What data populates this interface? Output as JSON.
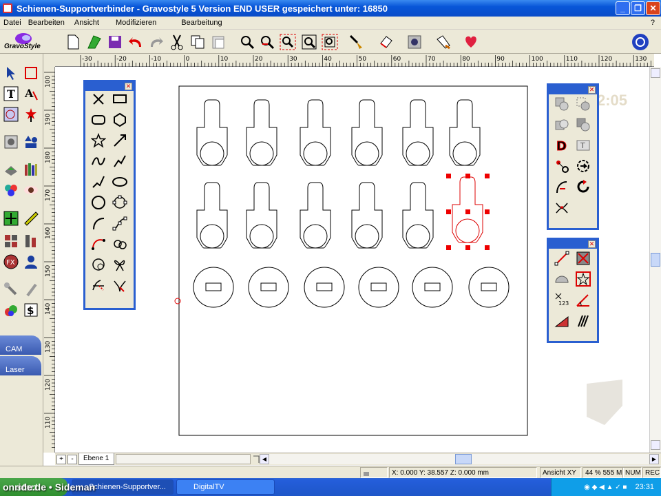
{
  "window": {
    "title": "Schienen-Supportverbinder - Gravostyle 5  Version END USER gespeichert unter: 16850",
    "minimize": "_",
    "maximize": "❐",
    "close": "✕"
  },
  "menu": [
    "Datei",
    "Bearbeiten",
    "Ansicht",
    "Modifizieren",
    "Bearbeitung"
  ],
  "menu_help": "?",
  "logo_text": "GravoStyle",
  "ruler_top_labels": [
    "-30",
    "-20",
    "-10",
    "0",
    "10",
    "20",
    "30",
    "40",
    "50",
    "60",
    "70",
    "80",
    "90",
    "100",
    "110",
    "120",
    "130"
  ],
  "ruler_left_labels": [
    "100",
    "190",
    "180",
    "170",
    "160",
    "150",
    "140",
    "130",
    "120",
    "110"
  ],
  "left_panels": {
    "cam": "CAM",
    "laser": "Laser"
  },
  "overlay_clock": "2:05",
  "layer_tab": "Ebene 1",
  "layer_add": "+",
  "layer_remove": "-",
  "status": {
    "coords": "X: 0.000   Y: 38.557   Z: 0.000 mm",
    "view": "Ansicht XY",
    "zoom": "44 % 555 M",
    "num": "NUM",
    "rec": "REC"
  },
  "taskbar": {
    "start": "start",
    "tasks": [
      {
        "label": "Schienen-Supportver..."
      },
      {
        "label": "DigitalTV"
      }
    ],
    "clock": "23:31"
  },
  "watermark": "onride.de • Sideman",
  "icons": {
    "toolbar": [
      "new-document-icon",
      "open-file-icon",
      "save-icon",
      "undo-icon",
      "redo-icon",
      "cut-icon",
      "copy-icon",
      "paste-icon",
      "zoom-icon",
      "zoom-in-icon",
      "zoom-selection-icon",
      "zoom-page-icon",
      "zoom-all-icon",
      "paint-brush-icon",
      "eraser-icon",
      "wizard-icon",
      "engrave-icon",
      "heart-icon",
      "gravograph-icon"
    ],
    "left": [
      "arrow-select-icon",
      "rectangle-icon",
      "text-icon",
      "font-icon",
      "node-edit-icon",
      "star-pin-icon",
      "image-icon",
      "shapes-icon",
      "stamp-icon",
      "library-icon",
      "eye-icon",
      "move-icon",
      "ruler-icon",
      "align-icon",
      "copy-array-icon",
      "fx-icon",
      "user-icon",
      "tools-icon",
      "paint-icon",
      "price-icon"
    ]
  }
}
